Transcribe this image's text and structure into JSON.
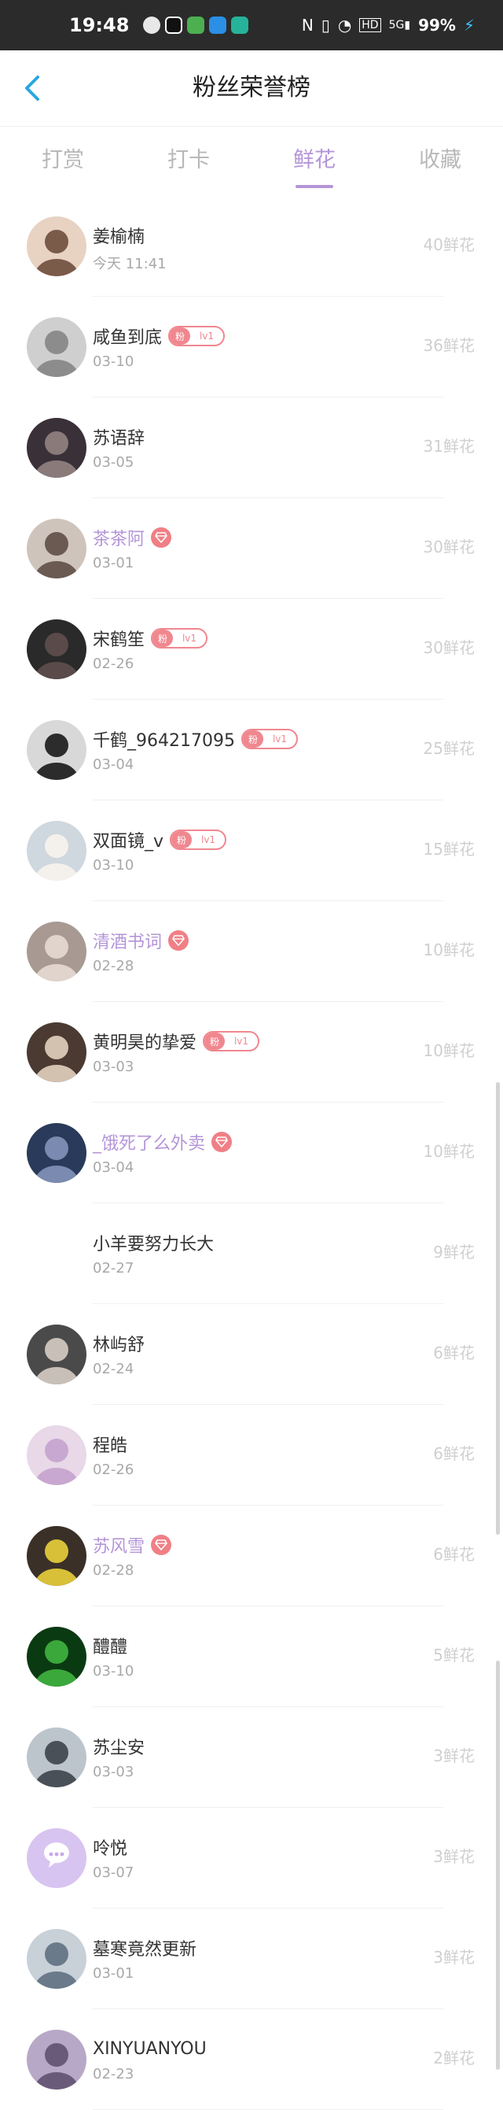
{
  "status_bar": {
    "time": "19:48",
    "battery": "99%",
    "network": "5G"
  },
  "header": {
    "title": "粉丝荣誉榜"
  },
  "tabs": [
    {
      "label": "打赏",
      "active": false
    },
    {
      "label": "打卡",
      "active": false
    },
    {
      "label": "鲜花",
      "active": true
    },
    {
      "label": "收藏",
      "active": false
    }
  ],
  "colors": {
    "accent": "#b495d8",
    "badge": "#f0878f",
    "count": "#cfcfcf"
  },
  "badge_labels": {
    "fan": "粉",
    "level": "lv1"
  },
  "fans": [
    {
      "name": "姜榆楠",
      "date": "今天 11:41",
      "count": "40鲜花",
      "badge": "none",
      "vip": false
    },
    {
      "name": "咸鱼到底",
      "date": "03-10",
      "count": "36鲜花",
      "badge": "fan",
      "vip": false
    },
    {
      "name": "苏语辞",
      "date": "03-05",
      "count": "31鲜花",
      "badge": "none",
      "vip": false
    },
    {
      "name": "茶茶阿",
      "date": "03-01",
      "count": "30鲜花",
      "badge": "vip",
      "vip": true
    },
    {
      "name": "宋鹤笙",
      "date": "02-26",
      "count": "30鲜花",
      "badge": "fan",
      "vip": false
    },
    {
      "name": "千鹤_964217095",
      "date": "03-04",
      "count": "25鲜花",
      "badge": "fan",
      "vip": false
    },
    {
      "name": "双面镜_v",
      "date": "03-10",
      "count": "15鲜花",
      "badge": "fan",
      "vip": false
    },
    {
      "name": "清酒书词",
      "date": "02-28",
      "count": "10鲜花",
      "badge": "vip",
      "vip": true
    },
    {
      "name": "黄明昊的挚爱",
      "date": "03-03",
      "count": "10鲜花",
      "badge": "fan",
      "vip": false
    },
    {
      "name": "_饿死了么外卖",
      "date": "03-04",
      "count": "10鲜花",
      "badge": "vip",
      "vip": true
    },
    {
      "name": "小羊要努力长大",
      "date": "02-27",
      "count": "9鲜花",
      "badge": "none",
      "vip": false
    },
    {
      "name": "林屿舒",
      "date": "02-24",
      "count": "6鲜花",
      "badge": "none",
      "vip": false
    },
    {
      "name": "程皓",
      "date": "02-26",
      "count": "6鲜花",
      "badge": "none",
      "vip": false
    },
    {
      "name": "苏风雪",
      "date": "02-28",
      "count": "6鲜花",
      "badge": "vip",
      "vip": true
    },
    {
      "name": "醴醴",
      "date": "03-10",
      "count": "5鲜花",
      "badge": "none",
      "vip": false
    },
    {
      "name": "苏尘安",
      "date": "03-03",
      "count": "3鲜花",
      "badge": "none",
      "vip": false
    },
    {
      "name": "呤悦",
      "date": "03-07",
      "count": "3鲜花",
      "badge": "none",
      "vip": false
    },
    {
      "name": "墓寒竟然更新",
      "date": "03-01",
      "count": "3鲜花",
      "badge": "none",
      "vip": false
    },
    {
      "name": "XINYUANYOU",
      "date": "02-23",
      "count": "2鲜花",
      "badge": "none",
      "vip": false
    }
  ]
}
